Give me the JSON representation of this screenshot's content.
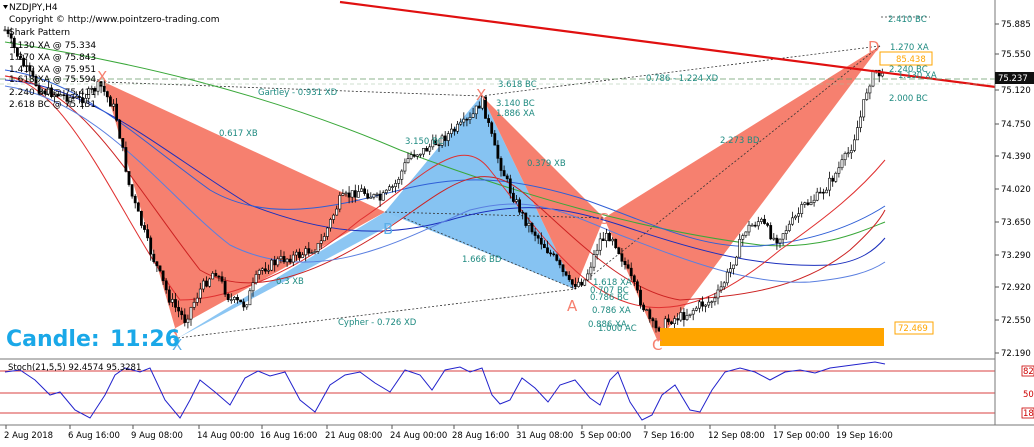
{
  "header": {
    "symbol": "NZDJPY,H4",
    "copyright": "Copyright © http://www.pointzero-trading.com",
    "pattern_name": "Shark Pattern",
    "levels": [
      "1.130 XA @ 75.334",
      "1.270 XA @ 75.843",
      "1.410 XA @ 75.951",
      "1.618 XA @ 75.594",
      "2.240 BC @ 75.411",
      "2.618 BC @ 75.131"
    ]
  },
  "candle_timer": {
    "label": "Candle:",
    "value": "11:26"
  },
  "colors": {
    "bearish_fill": "#f6806f",
    "bullish_fill": "#86c3f2",
    "trendline": "#e01010",
    "prz_box": "#ffa500",
    "current_price_tag": "#101010",
    "stoch_main": "#2222cc",
    "stoch_level": "#cc0000",
    "label_teal": "#1e8a80"
  },
  "price_axis": {
    "ticks": [
      "75.885",
      "75.550",
      "75.237",
      "75.120",
      "74.750",
      "74.390",
      "74.020",
      "73.650",
      "73.290",
      "72.920",
      "72.550",
      "72.190"
    ],
    "current_price": "75.237",
    "prz_price": "72.469"
  },
  "time_axis": {
    "labels": [
      "2 Aug 2018",
      "6 Aug 16:00",
      "9 Aug 08:00",
      "14 Aug 00:00",
      "16 Aug 16:00",
      "21 Aug 08:00",
      "24 Aug 00:00",
      "28 Aug 16:00",
      "31 Aug 08:00",
      "5 Sep 00:00",
      "7 Sep 16:00",
      "12 Sep 08:00",
      "17 Sep 00:00",
      "19 Sep 16:00"
    ]
  },
  "pattern_points": {
    "x1": "X",
    "b1": "B",
    "x2": "X",
    "a2": "A",
    "c2": "C",
    "c3": "C",
    "d3": "D"
  },
  "ratio_labels": {
    "gartley": "Gartley - 0.931 XD",
    "r0617": "0.617 XB",
    "r3150": "3.150 BC",
    "rxb": "0.3 XB",
    "cypher": "Cypher - 0.726 XD",
    "r1666": "1.666 BD",
    "r3618": "3.618 BC",
    "r3140": "3.140 BC",
    "r1886": "1.886 XA",
    "r0379": "0.379 XB",
    "r2273": "2.273 BD",
    "r1224": "0.786 - 1.224 XD",
    "r2410": "2.410 BC",
    "r1270": "1.270 XA",
    "r1130": "1.130 XA",
    "r85438": "85.438",
    "r2240": "2.240 BC",
    "r2000": "2.000 BC",
    "a1618": "1.618 XA",
    "a0707": "0.707 BC",
    "a0786": "0.786 BC",
    "a0786xa": "0.786 XA",
    "a0886": "0.886 XA",
    "a1000": "1.000 AC"
  },
  "stoch": {
    "label": "Stoch(21,5,5) 92.4574 95.3281",
    "levels": [
      "82",
      "50",
      "18"
    ]
  }
}
